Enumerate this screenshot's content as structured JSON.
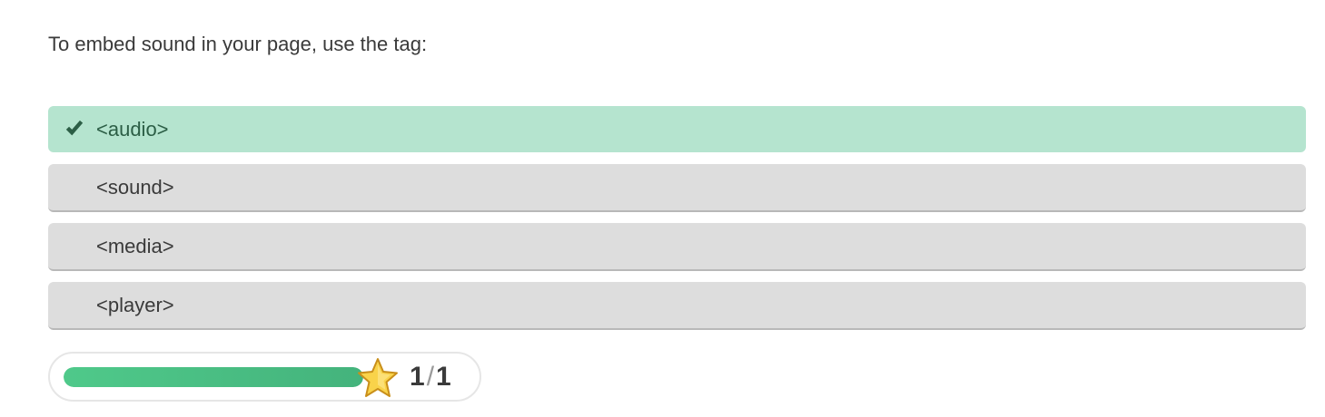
{
  "question": {
    "text": "To embed sound in your page, use the tag:"
  },
  "options": [
    {
      "label": "<audio>",
      "state": "correct",
      "icon": "check-icon"
    },
    {
      "label": "<sound>",
      "state": "unselected"
    },
    {
      "label": "<media>",
      "state": "unselected"
    },
    {
      "label": "<player>",
      "state": "unselected"
    }
  ],
  "progress": {
    "fraction": 1.0,
    "score": "1",
    "separator": "/",
    "total": "1",
    "icon": "star-icon"
  },
  "colors": {
    "correct_bg": "#b5e4cf",
    "option_bg": "#dddddd",
    "progress_fill": "#4fc98a",
    "star_fill": "#f9d34a"
  }
}
